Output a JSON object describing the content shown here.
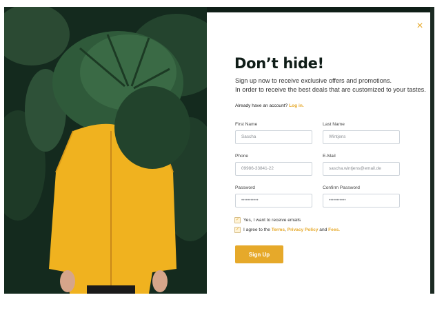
{
  "close_icon": "×",
  "title": "Don’t hide!",
  "subtitle": {
    "line1": "Sign up now to receive exclusive offers and promotions.",
    "line2": "In order to receive the best deals that are customized to your tastes."
  },
  "account": {
    "prompt": "Already have an account?",
    "link": "Log in."
  },
  "fields": {
    "first_name": {
      "label": "First Name",
      "value": "Sascha"
    },
    "last_name": {
      "label": "Last Name",
      "value": "Wintjens"
    },
    "phone": {
      "label": "Phone",
      "value": "09986-33841-22"
    },
    "email": {
      "label": "E-Mail",
      "value": "sascha.wintjens@email.de"
    },
    "password": {
      "label": "Password",
      "value": "•••••••••••"
    },
    "confirm_password": {
      "label": "Confirm Password",
      "value": "•••••••••••"
    }
  },
  "checkboxes": {
    "emails": {
      "label": "Yes, I want to receive emails",
      "checked": true
    },
    "terms": {
      "prefix": "I agree to the",
      "terms_link": "Terms",
      "comma": ",",
      "privacy_link": "Privacy Policy",
      "and": "and",
      "fees_link": "Fees.",
      "checked": true
    }
  },
  "submit_label": "Sign Up",
  "colors": {
    "accent": "#e6a92a",
    "jacket": "#f0b21f",
    "foliage": "#1e3a27"
  },
  "icons": {
    "close": "close-icon",
    "check": "check-icon"
  }
}
